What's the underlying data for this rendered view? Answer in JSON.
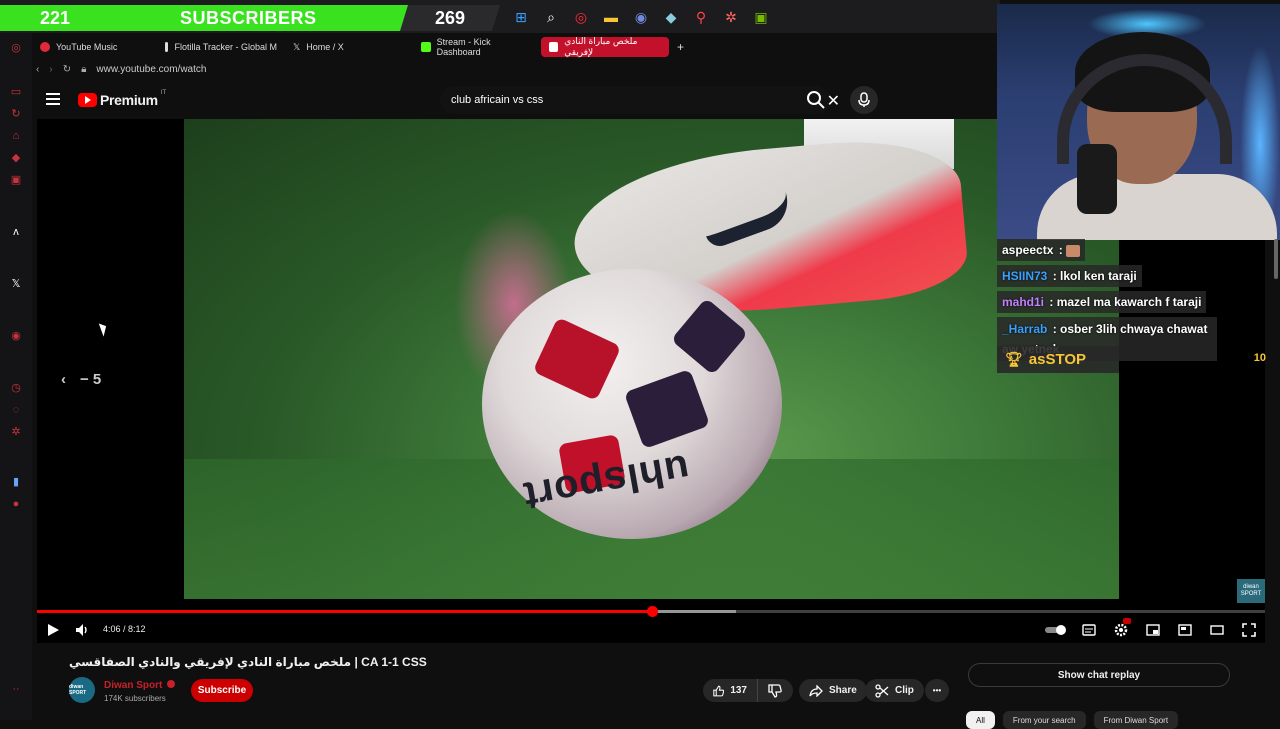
{
  "taskbar": {
    "sub_count": "221",
    "sub_label": "SUBSCRIBERS",
    "sub_goal": "269",
    "tray_icons": [
      "windows-icon",
      "search-icon",
      "opera-icon",
      "folder-icon",
      "discord-icon",
      "app-icon",
      "location-icon",
      "settings-icon",
      "nvidia-icon"
    ]
  },
  "browser": {
    "tabs": [
      {
        "label": "YouTube Music",
        "color": "#e02a3a",
        "active": false
      },
      {
        "label": "Flotilla Tracker - Global M",
        "color": "#dddddd",
        "active": false
      },
      {
        "label": "Home / X",
        "color": "#ffffff",
        "active": false
      },
      {
        "label": "Stream - Kick Dashboard",
        "color": "#53fc18",
        "active": false
      },
      {
        "label": "ملخص مباراة النادي لإفريقي",
        "color": "#ffffff",
        "active": true
      }
    ],
    "new_tab": "+",
    "url": "www.youtube.com/watch"
  },
  "youtube": {
    "logo_word": "Premium",
    "logo_country": "IT",
    "search_value": "club africain vs css",
    "clear_glyph": "✕"
  },
  "player": {
    "seek_back_label": "‹   − 5",
    "seek_back_text": "− 5",
    "brand_on_ball": "uhlsport",
    "watermark_top": "diwa",
    "watermark_logo": "diwan SPORT",
    "current_time": "4:06",
    "duration": "8:12",
    "timecode": "4:06 / 8:12",
    "progress_played": 0.501,
    "progress_buffered": 0.569,
    "colors": {
      "accent": "#ff0000"
    }
  },
  "video_info": {
    "title": "ملخص مباراة النادي لإفريقي والنادي الصفاقسي | CA 1-1 CSS",
    "channel_name": "Diwan Sport",
    "channel_subs": "174K subscribers",
    "avatar_text": "diwan SPORT",
    "subscribe_label": "Subscribe",
    "like_count": "137",
    "share_label": "Share",
    "clip_label": "Clip",
    "more_label": "•••",
    "chat_replay_label": "Show chat replay",
    "chips": [
      "All",
      "From your search",
      "From Diwan Sport"
    ]
  },
  "stream_overlay": {
    "chat": [
      {
        "user": "aspeectx",
        "user_color": "#e8e8e8",
        "msg": ""
      },
      {
        "user": "HSIIN73",
        "user_color": "#3aa0ff",
        "msg": "lkol ken taraji"
      },
      {
        "user": "mahd1i",
        "user_color": "#c080ff",
        "msg": "mazel ma kawarch f taraji"
      },
      {
        "user": "_Harrab",
        "user_color": "#3aa0ff",
        "msg": "osber 3lih chwaya chawat aw yetnek"
      }
    ],
    "top_donor_name": "asSTOP",
    "top_donor_amount": "10"
  }
}
